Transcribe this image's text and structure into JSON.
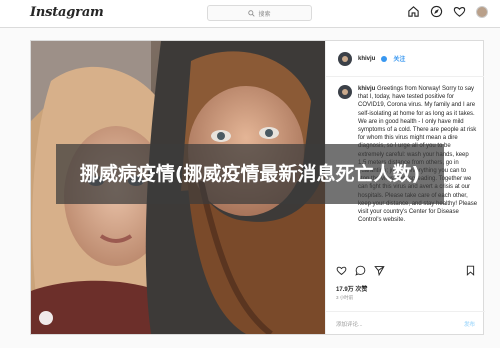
{
  "nav": {
    "logo": "Instagram",
    "search_placeholder": "搜索",
    "icons": [
      "home-icon",
      "explore-icon",
      "heart-icon",
      "profile-avatar"
    ]
  },
  "post": {
    "username": "khivju",
    "follow_label": "关注",
    "caption_user": "khivju",
    "caption": "Greetings from Norway! Sorry to say that I, today, have tested positive for COVID19, Corona virus. My family and I are self-isolating at home for as long as it takes. We are in good health - I only have mild symptoms of a cold. There are people at risk for whom this virus might mean a dire diagnosis, so I urge all of you to be extremely careful: wash your hands, keep 1.5 meters distance from others, go in quarantine; just do everything you can to stop the virus from spreading. Together we can fight this virus and avert a crisis at our hospitals. Please take care of each other, keep your distance, and stay healthy! Please visit your country's Center for Disease Control's website.",
    "likes": "17.9万 次赞",
    "date": "3 小时前",
    "comment_placeholder": "添加评论...",
    "post_label": "发布"
  },
  "overlay": {
    "title": "挪威病疫情(挪威疫情最新消息死亡人数)"
  },
  "colors": {
    "accent": "#3897f0",
    "border": "#dbdbdb",
    "overlay": "#3c3c3c"
  }
}
